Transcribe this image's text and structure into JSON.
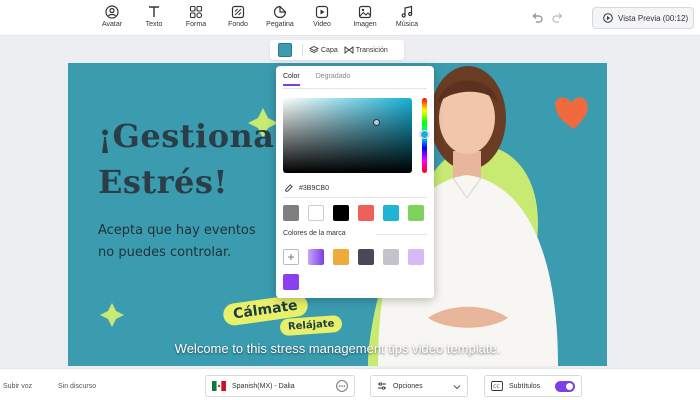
{
  "toolbar": {
    "tools": [
      {
        "label": "Avatar",
        "icon": "avatar-icon"
      },
      {
        "label": "Texto",
        "icon": "text-icon"
      },
      {
        "label": "Forma",
        "icon": "shapes-icon"
      },
      {
        "label": "Fondo",
        "icon": "background-icon"
      },
      {
        "label": "Pegatina",
        "icon": "sticker-icon"
      },
      {
        "label": "Video",
        "icon": "video-icon"
      },
      {
        "label": "Imagen",
        "icon": "image-icon"
      },
      {
        "label": "Música",
        "icon": "music-icon"
      }
    ],
    "preview_label": "Vista Previa (00:12)"
  },
  "subbar": {
    "current_color": "#3B9CB0",
    "layer_label": "Capa",
    "transition_label": "Transición"
  },
  "canvas": {
    "background": "#3B9CB0",
    "headline_line1": "¡Gestiona",
    "headline_line2": "Estrés!",
    "body_line1": "Acepta que hay eventos",
    "body_line2": "no puedes controlar.",
    "tag1": "Cálmate",
    "tag2": "Relájate",
    "subtitle": "Welcome to this stress management tips video template."
  },
  "picker": {
    "tab_color": "Color",
    "tab_gradient": "Degradado",
    "hex_value": "#3B9CB0",
    "basic_colors": [
      "#7f7f7f",
      "#ffffff",
      "#000000",
      "#f0605a",
      "#1fb4d6",
      "#7ed45a"
    ],
    "brand_label": "Colores de la marca",
    "brand_colors": [
      "gradient-purple",
      "#f0a93b",
      "#474a56",
      "#c3c3cd",
      "#d6b9f5",
      "#8a3ff0"
    ]
  },
  "bottombar": {
    "upload_voice": "Subir voz",
    "no_speech": "Sin discurso",
    "voice": "Spanish(MX) - Dalia",
    "options": "Opciones",
    "subtitles": "Subtítulos"
  }
}
